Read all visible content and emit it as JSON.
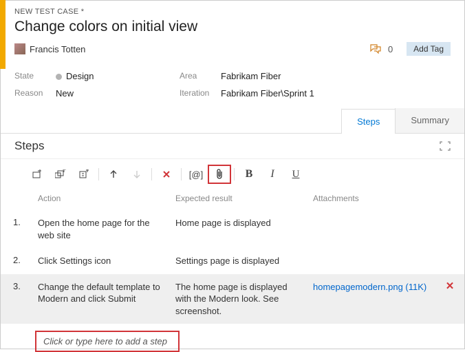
{
  "breadcrumb": "NEW TEST CASE *",
  "title": "Change colors on initial view",
  "assignee": "Francis Totten",
  "discussion_count": "0",
  "add_tag_label": "Add Tag",
  "fields": {
    "state_label": "State",
    "state_value": "Design",
    "reason_label": "Reason",
    "reason_value": "New",
    "area_label": "Area",
    "area_value": "Fabrikam Fiber",
    "iteration_label": "Iteration",
    "iteration_value": "Fabrikam Fiber\\Sprint 1"
  },
  "tabs": {
    "steps": "Steps",
    "summary": "Summary"
  },
  "section_title": "Steps",
  "columns": {
    "action": "Action",
    "expected": "Expected result",
    "attachments": "Attachments"
  },
  "steps": [
    {
      "num": "1.",
      "action": "Open the home page for the web site",
      "expected": "Home page is displayed",
      "attachment": ""
    },
    {
      "num": "2.",
      "action": "Click Settings icon",
      "expected": "Settings page is displayed",
      "attachment": ""
    },
    {
      "num": "3.",
      "action": "Change the default template to Modern and click Submit",
      "expected": "The home page is displayed with the Modern look. See screenshot.",
      "attachment": "homepagemodern.png (11K)"
    }
  ],
  "add_step_placeholder": "Click or type here to add a step",
  "toolbar_icons": {
    "bold": "B",
    "italic": "I",
    "underline": "U",
    "delete": "✕",
    "param": "[@]"
  }
}
